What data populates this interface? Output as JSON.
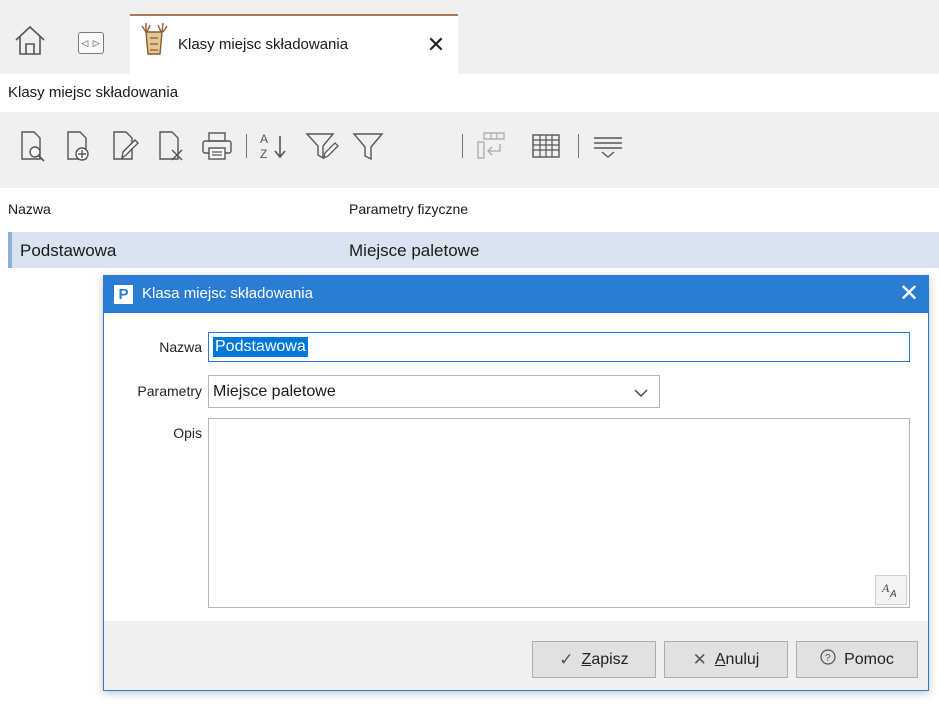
{
  "tabbar": {
    "tab_title": "Klasy miejsc składowania",
    "nav_glyph": "◁ ▷"
  },
  "page": {
    "title": "Klasy miejsc składowania"
  },
  "toolbar": {
    "icons": [
      "preview-document-icon",
      "add-document-icon",
      "edit-document-icon",
      "delete-document-icon",
      "print-icon",
      "sort-az-icon",
      "filter-edit-icon",
      "filter-icon",
      "export-rows-icon",
      "grid-icon",
      "column-chooser-icon"
    ]
  },
  "list": {
    "columns": [
      "Nazwa",
      "Parametry fizyczne"
    ],
    "rows": [
      {
        "nazwa": "Podstawowa",
        "parametry": "Miejsce paletowe"
      }
    ]
  },
  "dialog": {
    "logo": "P",
    "title": "Klasa miejsc składowania",
    "close_glyph": "✕",
    "fields": {
      "nazwa_label": "Nazwa",
      "nazwa_value": "Podstawowa",
      "parametry_label": "Parametry",
      "parametry_value": "Miejsce paletowe",
      "opis_label": "Opis",
      "opis_value": ""
    },
    "buttons": {
      "save_hotkey": "Z",
      "save_rest": "apisz",
      "cancel_hotkey": "A",
      "cancel_rest": "nuluj",
      "help_label": "Pomoc"
    }
  },
  "colors": {
    "accent": "#2b7cd3",
    "selection": "#0078d7",
    "row_highlight": "#d9e4f1",
    "tab_accent": "#a9775c"
  }
}
